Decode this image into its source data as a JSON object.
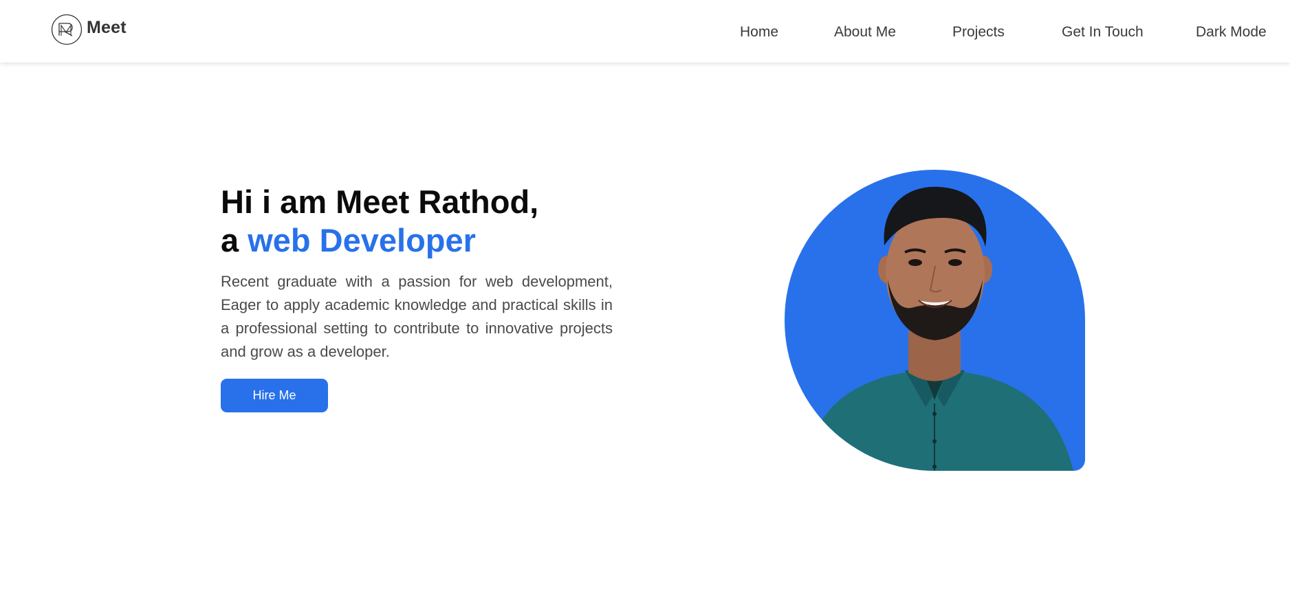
{
  "header": {
    "brand": "Meet",
    "nav": [
      "Home",
      "About Me",
      "Projects",
      "Get In Touch",
      "Dark Mode"
    ]
  },
  "hero": {
    "title_line1": "Hi i am Meet Rathod,",
    "title_prefix": "a",
    "title_highlight": "web Developer",
    "description": "Recent graduate with a passion for web development, Eager to apply academic knowledge and practical skills in a professional setting to contribute to innovative projects and grow as a developer.",
    "cta": "Hire Me"
  },
  "icons": {
    "logo": "monogram-logo-icon",
    "portrait": "profile-photo"
  },
  "colors": {
    "accent": "#2871ea",
    "text": "#0b0b0b",
    "muted": "#4a4a4a",
    "shirt": "#1f6f77",
    "skin": "#b07659"
  }
}
